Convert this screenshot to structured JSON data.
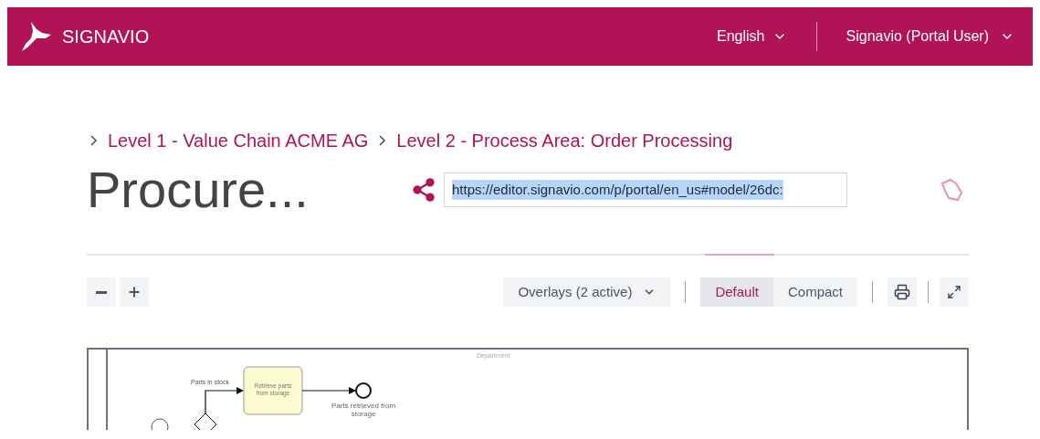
{
  "header": {
    "brand": "SIGNAVIO",
    "language": "English",
    "user": "Signavio (Portal User)"
  },
  "breadcrumbs": [
    "Level 1 - Value Chain ACME AG",
    "Level 2 - Process Area: Order Processing"
  ],
  "title": "Procure...",
  "share": {
    "url": "https://editor.signavio.com/p/portal/en_us#model/26dc:",
    "selected": true
  },
  "toolbar": {
    "overlays": "Overlays (2 active)",
    "views": [
      {
        "label": "Default",
        "selected": true
      },
      {
        "label": "Compact",
        "selected": false
      }
    ]
  },
  "diagram": {
    "pool_label": "Department",
    "condition": "Parts in stock",
    "task": [
      "Retrieve parts",
      "from storage"
    ],
    "end_event": [
      "Parts retrieved from",
      "storage"
    ]
  }
}
